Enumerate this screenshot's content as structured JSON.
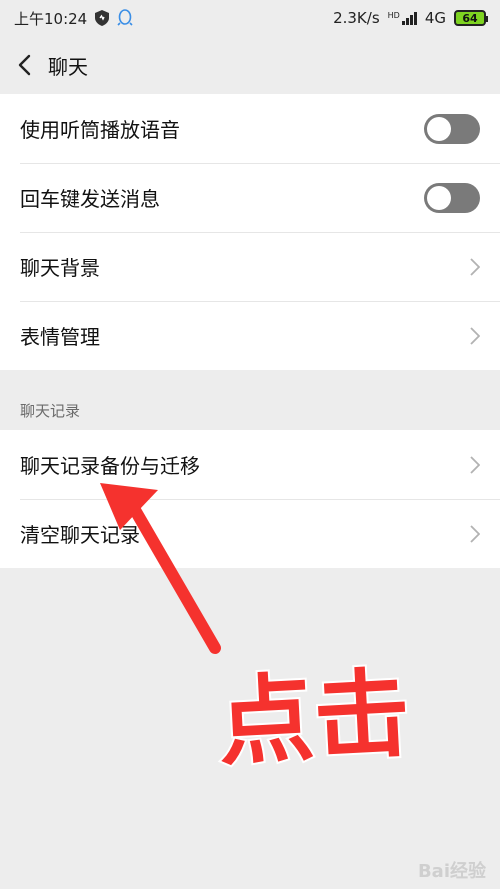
{
  "status_bar": {
    "time": "上午10:24",
    "network_speed": "2.3K/s",
    "hd_label": "HD",
    "network_type": "4G",
    "battery": "64"
  },
  "nav": {
    "title": "聊天"
  },
  "groups": [
    {
      "rows": [
        {
          "label": "使用听筒播放语音",
          "control": "toggle",
          "on": false
        },
        {
          "label": "回车键发送消息",
          "control": "toggle",
          "on": false
        },
        {
          "label": "聊天背景",
          "control": "chevron"
        },
        {
          "label": "表情管理",
          "control": "chevron"
        }
      ]
    },
    {
      "header": "聊天记录",
      "rows": [
        {
          "label": "聊天记录备份与迁移",
          "control": "chevron"
        },
        {
          "label": "清空聊天记录",
          "control": "chevron"
        }
      ]
    }
  ],
  "annotation": {
    "text": "点击",
    "color": "#f5322e"
  },
  "watermark": "Bai经验",
  "colors": {
    "background": "#ededed",
    "toggle_off": "#7a7a7a"
  }
}
